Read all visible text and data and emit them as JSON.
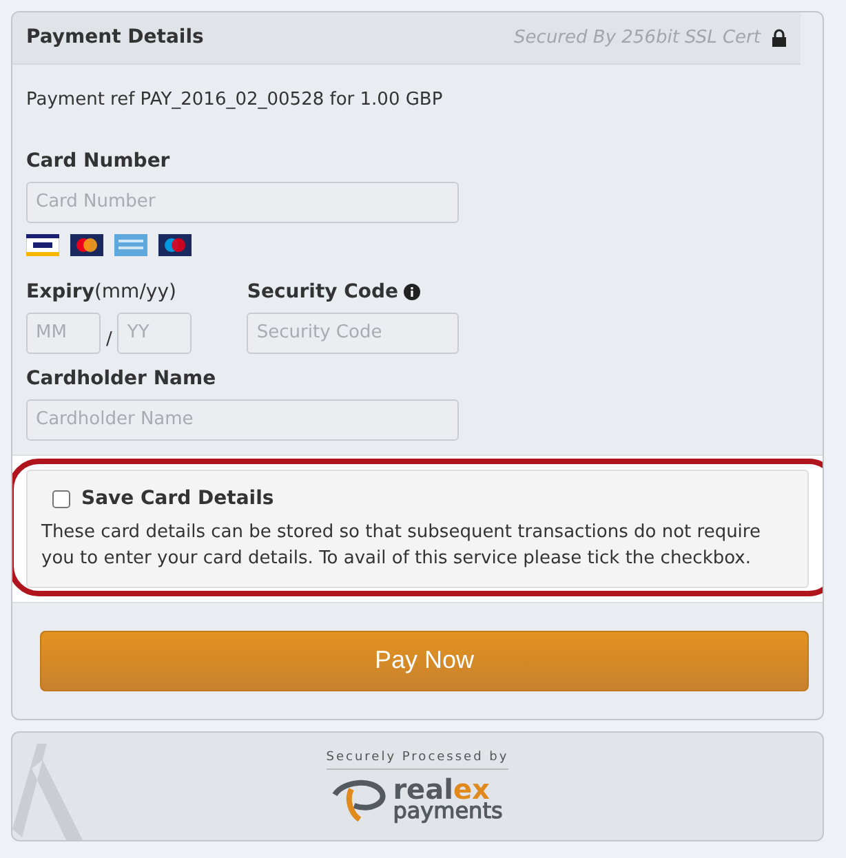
{
  "header": {
    "title": "Payment Details",
    "secure_note": "Secured By 256bit SSL Cert"
  },
  "payment_ref": "Payment ref PAY_2016_02_00528 for 1.00 GBP",
  "card_number": {
    "label": "Card Number",
    "placeholder": "Card Number"
  },
  "card_brands": [
    {
      "kind": "visa"
    },
    {
      "kind": "mastercard"
    },
    {
      "kind": "amex"
    },
    {
      "kind": "maestro"
    }
  ],
  "expiry": {
    "label": "Expiry",
    "hint": "(mm/yy)",
    "month_placeholder": "MM",
    "separator": "/",
    "year_placeholder": "YY"
  },
  "security_code": {
    "label": "Security Code",
    "placeholder": "Security Code"
  },
  "cardholder_name": {
    "label": "Cardholder Name",
    "placeholder": "Cardholder Name"
  },
  "save_card": {
    "label": "Save Card Details",
    "checked": false,
    "highlighted": true,
    "description": "These card details can be stored so that subsequent transactions do not require you to enter your card details. To avail of this service please tick the checkbox."
  },
  "pay_button": "Pay Now",
  "footer": {
    "caption": "Securely Processed by",
    "logo_dark": "real",
    "logo_accent": "ex",
    "logo_sub": "payments"
  }
}
